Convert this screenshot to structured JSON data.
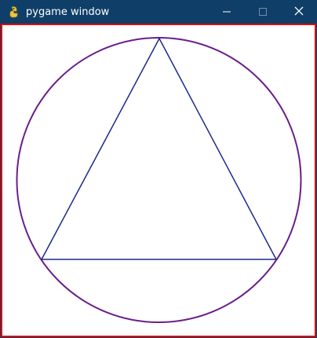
{
  "window": {
    "title": "pygame window",
    "app_icon": "pygame-snake-icon",
    "controls": {
      "minimize_icon": "minimize-icon",
      "maximize_icon": "maximize-icon",
      "close_icon": "close-icon"
    }
  },
  "colors": {
    "titlebar": "#0f3f68",
    "border": "#e00000",
    "circle": "#6a1f8a",
    "triangle": "#1b2a8c"
  }
}
